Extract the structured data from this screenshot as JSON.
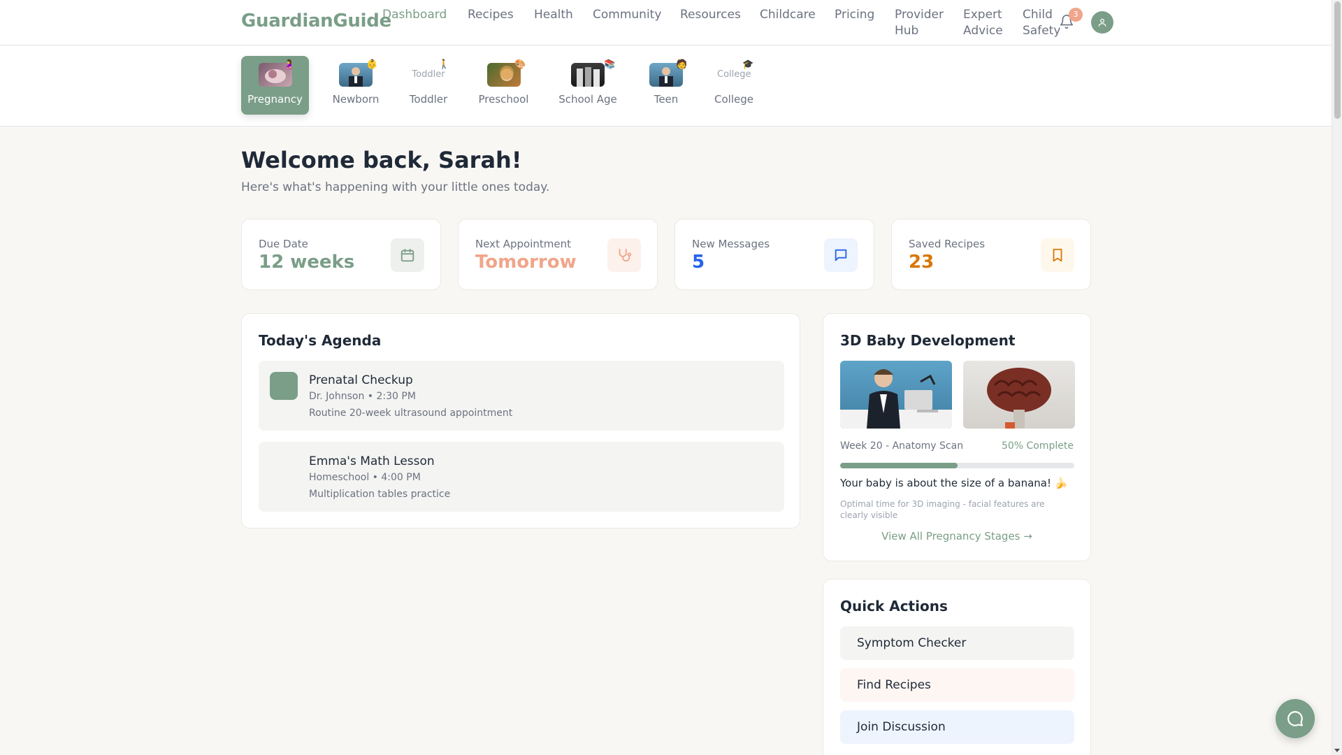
{
  "brand": {
    "name": "GuardianGuide",
    "accent": "#7a9e87"
  },
  "nav": {
    "links": [
      {
        "label": "Dashboard",
        "active": true
      },
      {
        "label": "Recipes"
      },
      {
        "label": "Health"
      },
      {
        "label": "Community"
      },
      {
        "label": "Resources"
      },
      {
        "label": "Childcare"
      },
      {
        "label": "Pricing"
      },
      {
        "label": "Provider Hub"
      },
      {
        "label": "Expert Advice"
      },
      {
        "label": "Child Safety"
      }
    ],
    "notification_count": "3",
    "icons": [
      "bell-icon",
      "user-icon"
    ]
  },
  "stages": [
    {
      "label": "Pregnancy",
      "active": true
    },
    {
      "label": "Newborn"
    },
    {
      "label": "Toddler",
      "alt": "Toddler"
    },
    {
      "label": "Preschool"
    },
    {
      "label": "School Age"
    },
    {
      "label": "Teen"
    },
    {
      "label": "College",
      "alt": "College"
    }
  ],
  "welcome": {
    "title": "Welcome back, Sarah!",
    "subtitle": "Here's what's happening with your little ones today."
  },
  "stats": [
    {
      "label": "Due Date",
      "value": "12 weeks",
      "color": "#7a9e87",
      "icon": "calendar-icon"
    },
    {
      "label": "Next Appointment",
      "value": "Tomorrow",
      "color": "#f0a58a",
      "icon": "stethoscope-icon"
    },
    {
      "label": "New Messages",
      "value": "5",
      "color": "#2563eb",
      "icon": "message-icon"
    },
    {
      "label": "Saved Recipes",
      "value": "23",
      "color": "#d97706",
      "icon": "bookmark-icon"
    }
  ],
  "agenda": {
    "title": "Today's Agenda",
    "items": [
      {
        "title": "Prenatal Checkup",
        "meta": "Dr. Johnson • 2:30 PM",
        "desc": "Routine 20-week ultrasound appointment",
        "color": "#7a9e87"
      },
      {
        "title": "Emma's Math Lesson",
        "meta": "Homeschool • 4:00 PM",
        "desc": "Multiplication tables practice",
        "color": "#f4f4f2"
      }
    ]
  },
  "development": {
    "title": "3D Baby Development",
    "week": "Week 20 - Anatomy Scan",
    "percent_label": "50% Complete",
    "progress": 0.5,
    "size_text": "Your baby is about the size of a banana! 🍌",
    "note": "Optimal time for 3D imaging - facial features are clearly visible",
    "link": "View All Pregnancy Stages →"
  },
  "quick_actions": {
    "title": "Quick Actions",
    "items": [
      {
        "label": "Symptom Checker",
        "bg": "#f4f4f2"
      },
      {
        "label": "Find Recipes",
        "bg": "#fdf6f3"
      },
      {
        "label": "Join Discussion",
        "bg": "#eef4fd"
      }
    ]
  },
  "chat": {
    "icon": "chat-icon"
  }
}
